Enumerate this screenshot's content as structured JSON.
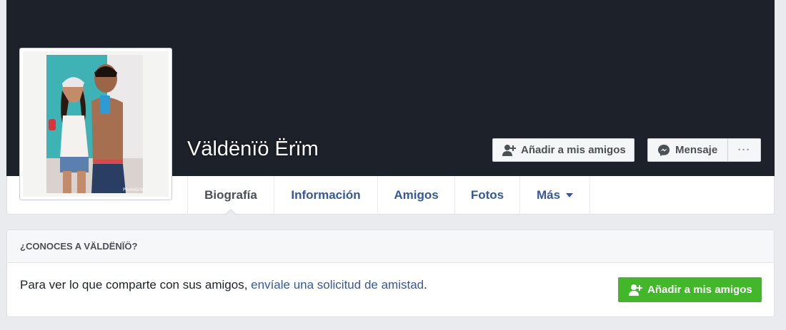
{
  "profile": {
    "name": "Väldënïö Ërïm"
  },
  "actions": {
    "add_friend_label": "Añadir a mis amigos",
    "message_label": "Mensaje",
    "more_label": "···"
  },
  "tabs": [
    {
      "label": "Biografía",
      "active": true
    },
    {
      "label": "Información",
      "active": false
    },
    {
      "label": "Amigos",
      "active": false
    },
    {
      "label": "Fotos",
      "active": false
    },
    {
      "label": "Más",
      "active": false
    }
  ],
  "know_card": {
    "title": "¿CONOCES A VÄLDËNÏÖ?",
    "text_prefix": "Para ver lo que comparte con sus amigos, ",
    "link_text": "envíale una solicitud de amistad",
    "text_suffix": ".",
    "button_label": "Añadir a mis amigos"
  },
  "colors": {
    "cover": "#1d2129",
    "link": "#365899",
    "green_button": "#42b72a"
  }
}
